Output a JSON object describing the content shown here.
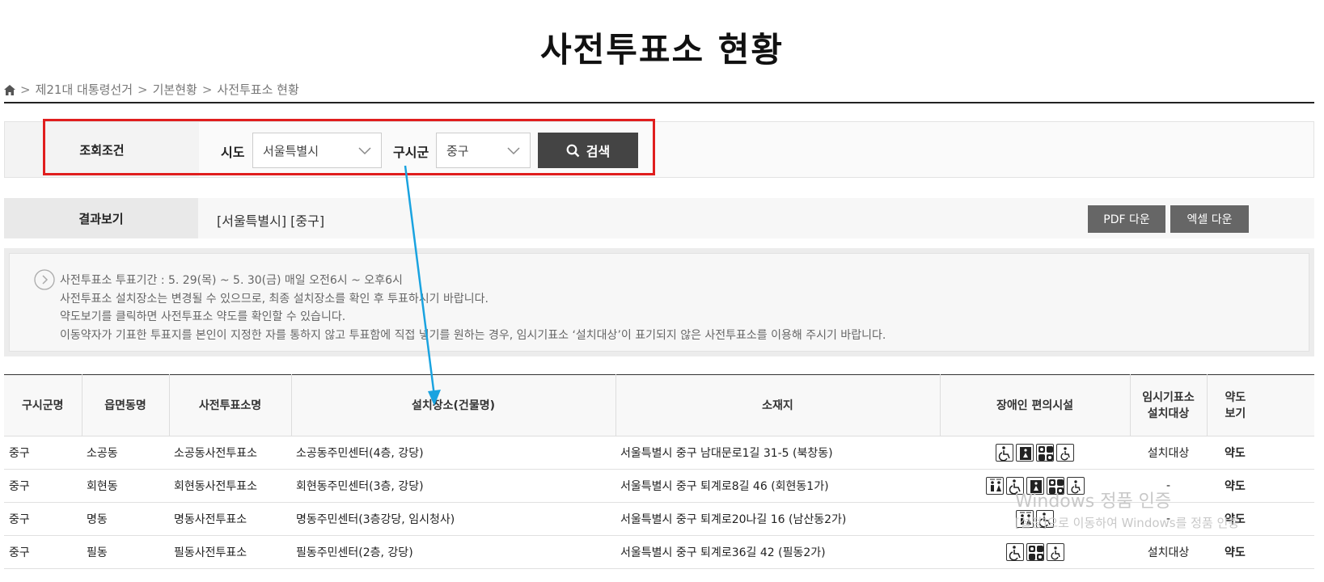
{
  "page": {
    "title": "사전투표소 현황"
  },
  "breadcrumb": {
    "items": [
      "제21대 대통령선거",
      "기본현황",
      "사전투표소 현황"
    ],
    "sep": ">"
  },
  "search": {
    "label": "조회조건",
    "sido_label": "시도",
    "sido_value": "서울특별시",
    "sigungu_label": "구시군",
    "sigungu_value": "중구",
    "button_label": "검색"
  },
  "result": {
    "label": "결과보기",
    "value": "[서울특별시] [중구]",
    "pdf_button": "PDF 다운",
    "excel_button": "엑셀 다운"
  },
  "notice": {
    "lines": [
      "사전투표소 투표기간 : 5. 29(목) ~ 5. 30(금) 매일 오전6시 ~ 오후6시",
      "사전투표소 설치장소는 변경될 수 있으므로, 최종 설치장소를 확인 후 투표하시기 바랍니다.",
      "약도보기를 클릭하면 사전투표소 약도를 확인할 수 있습니다.",
      "이동약자가 기표한 투표지를 본인이 지정한 자를 통하지 않고 투표함에 직접 넣기를 원하는 경우, 임시기표소 ‘설치대상’이 표기되지 않은 사전투표소를 이용해 주시기 바랍니다."
    ]
  },
  "table": {
    "headers": [
      "구시군명",
      "읍면동명",
      "사전투표소명",
      "설치장소(건물명)",
      "소재지",
      "장애인 편의시설",
      "임시기표소",
      "설치대상",
      "약도",
      "보기"
    ],
    "rows": [
      {
        "gu": "중구",
        "dong": "소공동",
        "name": "소공동사전투표소",
        "place": "소공동주민센터(4층, 강당)",
        "addr": "서울특별시 중구 남대문로1길 31-5 (북창동)",
        "temp": "설치대상",
        "map": "약도",
        "icons": [
          "wheelchair-icon",
          "elevator-icon",
          "braille-icon",
          "accessible-toilet-icon"
        ]
      },
      {
        "gu": "중구",
        "dong": "회현동",
        "name": "회현동사전투표소",
        "place": "회현동주민센터(3층, 강당)",
        "addr": "서울특별시 중구 퇴계로8길 46 (회현동1가)",
        "temp": "-",
        "map": "약도",
        "icons": [
          "restroom-icon",
          "wheelchair-icon",
          "elevator-icon",
          "braille-icon",
          "accessible-toilet-icon"
        ]
      },
      {
        "gu": "중구",
        "dong": "명동",
        "name": "명동사전투표소",
        "place": "명동주민센터(3층강당, 임시청사)",
        "addr": "서울특별시 중구 퇴계로20나길 16 (남산동2가)",
        "temp": "-",
        "map": "약도",
        "icons": [
          "restroom-icon",
          "wheelchair-icon"
        ]
      },
      {
        "gu": "중구",
        "dong": "필동",
        "name": "필동사전투표소",
        "place": "필동주민센터(2층, 강당)",
        "addr": "서울특별시 중구 퇴계로36길 42 (필동2가)",
        "temp": "설치대상",
        "map": "약도",
        "icons": [
          "wheelchair-icon",
          "braille-icon",
          "accessible-toilet-icon"
        ]
      }
    ]
  },
  "watermark": {
    "line1": "Windows 정품 인증",
    "line2": "[설정]으로 이동하여 Windows를 정품 인증"
  },
  "colors": {
    "highlight_border": "#e01e1e",
    "arrow": "#1aa3e0",
    "search_button": "#444444",
    "download_button": "#666666"
  }
}
